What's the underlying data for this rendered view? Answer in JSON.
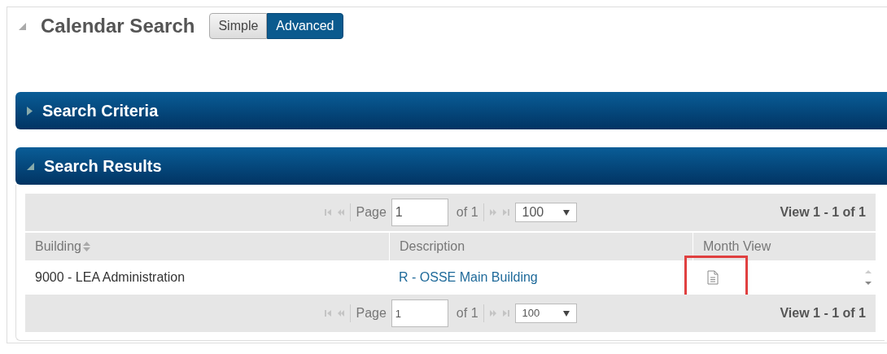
{
  "title": "Calendar Search",
  "expanded": true,
  "view_toggle": [
    {
      "label": "Simple",
      "selected": false
    },
    {
      "label": "Advanced",
      "selected": true
    }
  ],
  "criteria": {
    "title": "Search Criteria",
    "expanded": false
  },
  "results": {
    "title": "Search Results",
    "expanded": true,
    "pager_top": {
      "page_label": "Page",
      "page_value": "1",
      "of_text": "of 1",
      "page_size": "100",
      "view_text": "View 1 - 1 of 1"
    },
    "columns": [
      {
        "label": "Building",
        "sortable": true
      },
      {
        "label": "Description",
        "sortable": false
      },
      {
        "label": "Month View",
        "sortable": false
      }
    ],
    "rows": [
      {
        "building": "9000 - LEA Administration",
        "description": "R - OSSE Main Building",
        "month_view_highlighted": true
      }
    ],
    "pager_bottom": {
      "page_label": "Page",
      "page_value": "1",
      "of_text": "of 1",
      "page_size": "100",
      "view_text": "View 1 - 1 of 1"
    }
  }
}
